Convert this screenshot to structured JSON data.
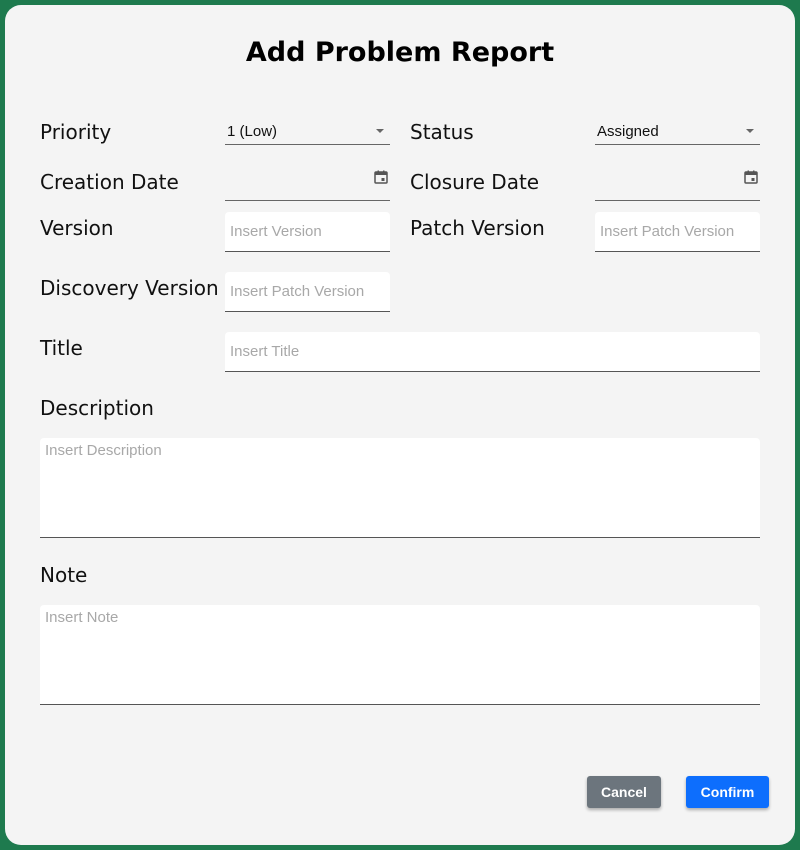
{
  "dialog": {
    "title": "Add Problem Report"
  },
  "fields": {
    "priority": {
      "label": "Priority",
      "value": "1 (Low)"
    },
    "status": {
      "label": "Status",
      "value": "Assigned"
    },
    "creation_date": {
      "label": "Creation Date",
      "value": ""
    },
    "closure_date": {
      "label": "Closure Date",
      "value": ""
    },
    "version": {
      "label": "Version",
      "placeholder": "Insert Version"
    },
    "patch_version": {
      "label": "Patch Version",
      "placeholder": "Insert Patch Version"
    },
    "discovery_version": {
      "label": "Discovery Version",
      "placeholder": "Insert Patch Version"
    },
    "title": {
      "label": "Title",
      "placeholder": "Insert Title"
    },
    "description": {
      "label": "Description",
      "placeholder": "Insert Description"
    },
    "note": {
      "label": "Note",
      "placeholder": "Insert Note"
    }
  },
  "actions": {
    "cancel_label": "Cancel",
    "confirm_label": "Confirm"
  },
  "colors": {
    "frame": "#1e7a4e",
    "cancel": "#6c757d",
    "confirm": "#0d6efd"
  }
}
